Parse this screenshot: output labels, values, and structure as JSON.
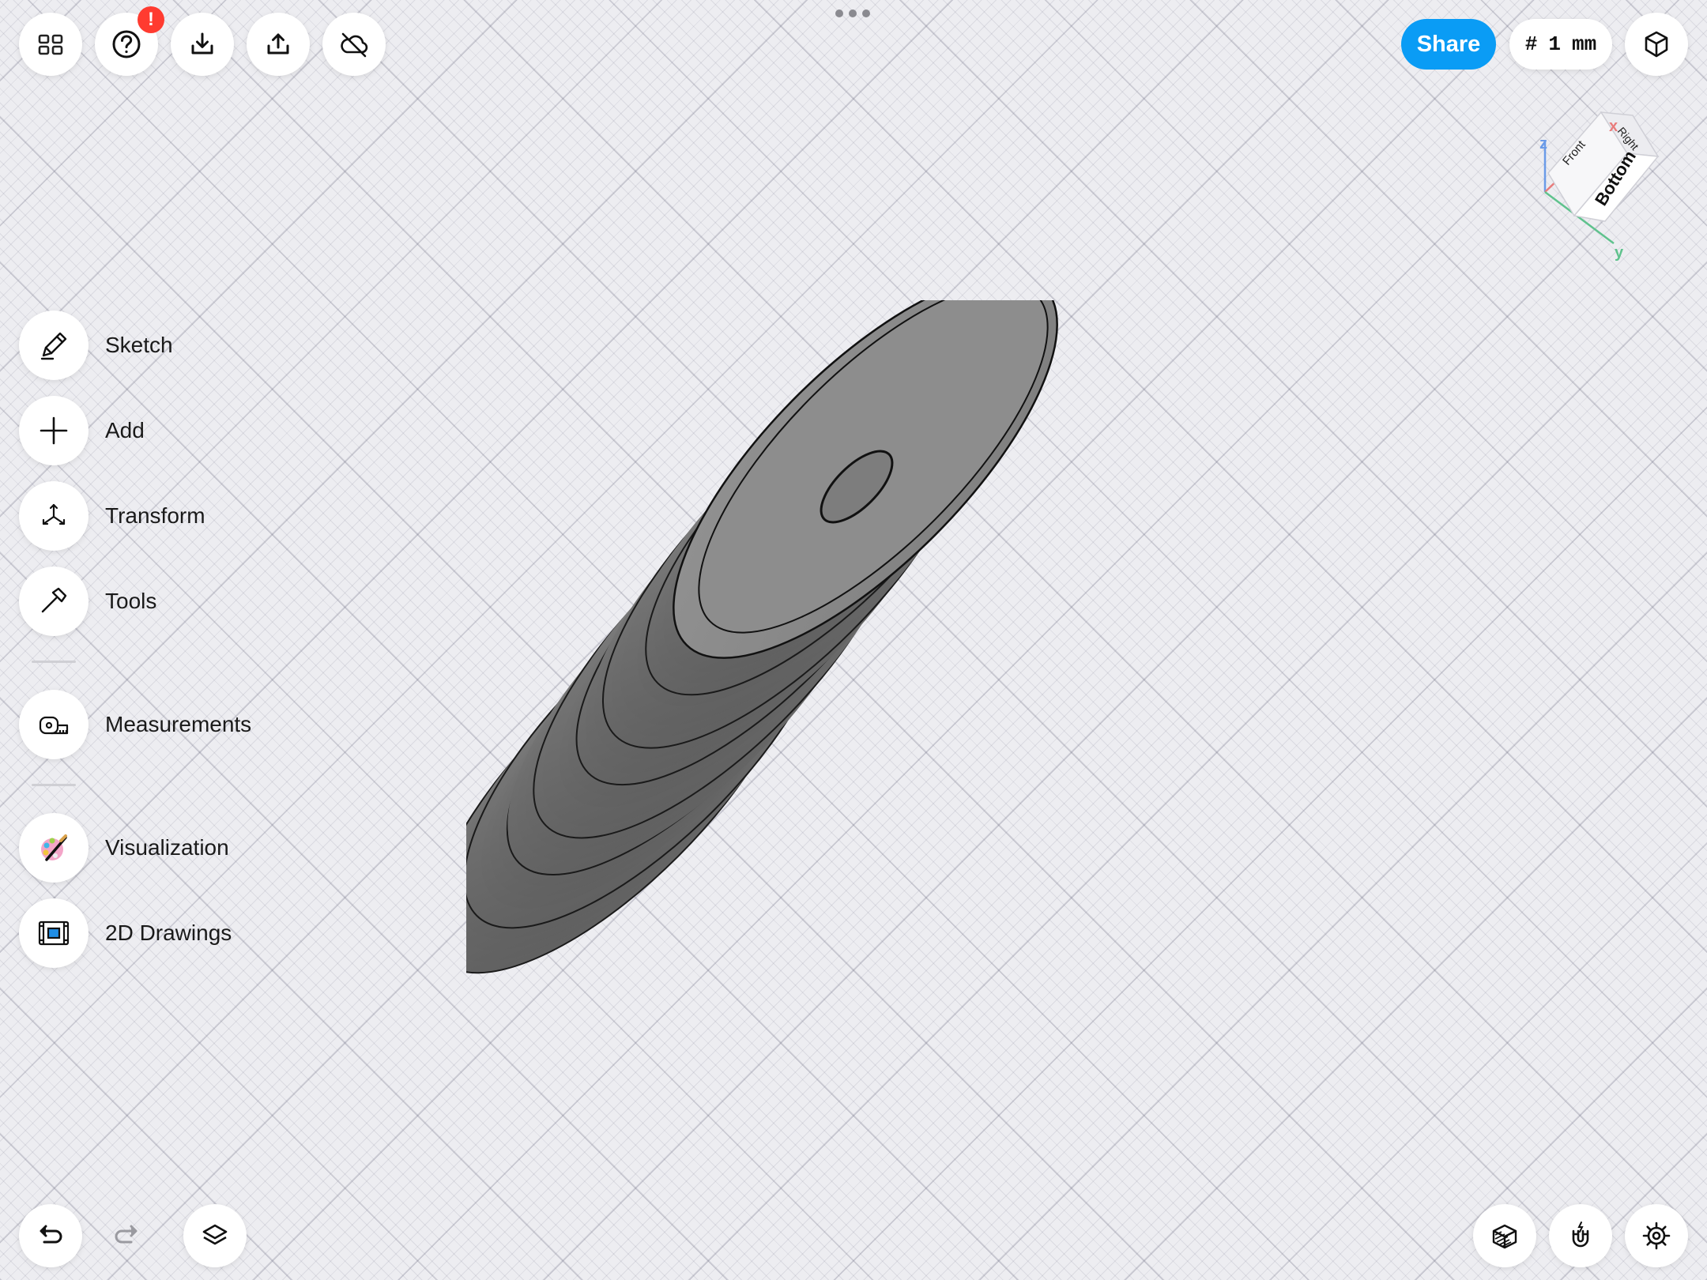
{
  "toolbar": {
    "left_icons": [
      "grid-icon",
      "help-icon",
      "import-icon",
      "export-icon",
      "cloud-off-icon"
    ],
    "help_badge": "!",
    "share_label": "Share",
    "grid_symbol": "#",
    "grid_value": "1",
    "grid_unit": "mm",
    "view_icon": "cube-view-icon"
  },
  "view_cube": {
    "face_top": "Front",
    "face_right": "Right",
    "face_main": "Bottom",
    "axis_x": "x",
    "axis_y": "y",
    "axis_z": "z"
  },
  "menu": {
    "sketch": "Sketch",
    "add": "Add",
    "transform": "Transform",
    "tools": "Tools",
    "measurements": "Measurements",
    "visualization": "Visualization",
    "drawings": "2D Drawings"
  },
  "bottom": {
    "left_icons": [
      "undo-icon",
      "redo-icon",
      "layers-icon"
    ],
    "right_icons": [
      "section-view-icon",
      "snap-magnet-icon",
      "settings-icon"
    ]
  },
  "colors": {
    "accent": "#0a9cf5",
    "badge": "#ff3b30",
    "background": "#ededf1",
    "model": "#808080"
  }
}
